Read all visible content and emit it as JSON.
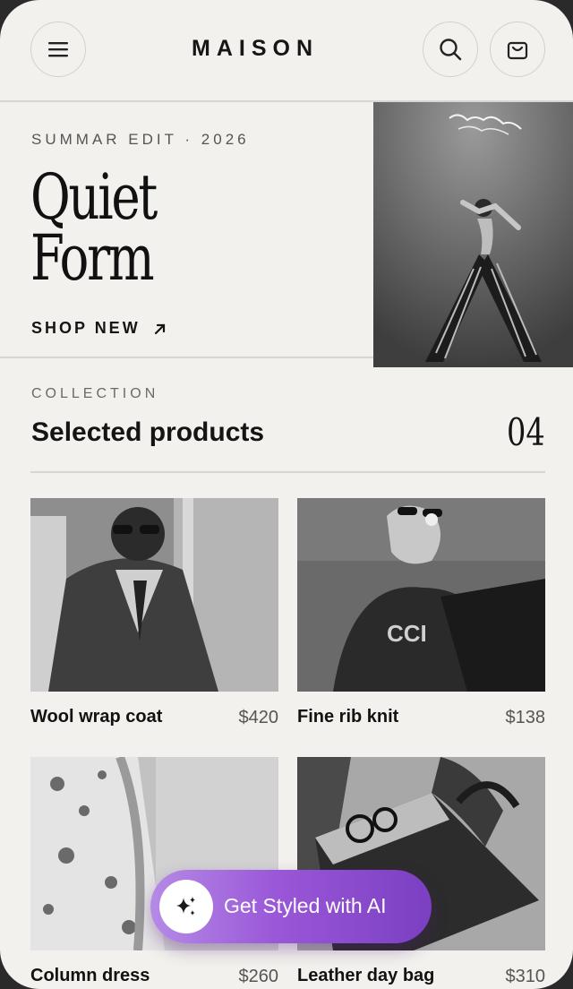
{
  "header": {
    "brand": "MAISON",
    "icons": {
      "menu": "hamburger-menu-icon",
      "search": "search-icon",
      "cart": "shopping-bag-icon"
    }
  },
  "hero": {
    "eyebrow": "SUMMAR EDIT · 2026",
    "title_line1": "Quiet",
    "title_line2": "Form",
    "cta_label": "SHOP NEW",
    "cta_icon": "arrow-up-right-icon"
  },
  "collection": {
    "eyebrow": "COLLECTION",
    "title": "Selected products",
    "count": "04",
    "products": [
      {
        "name": "Wool wrap coat",
        "price": "$420"
      },
      {
        "name": "Fine rib knit",
        "price": "$138"
      },
      {
        "name": "Column dress",
        "price": "$260"
      },
      {
        "name": "Leather day bag",
        "price": "$310"
      }
    ]
  },
  "ai_button": {
    "label": "Get Styled with AI",
    "icon": "sparkle-icon",
    "gradient_from": "#b58ae6",
    "gradient_to": "#7b3fc2"
  }
}
